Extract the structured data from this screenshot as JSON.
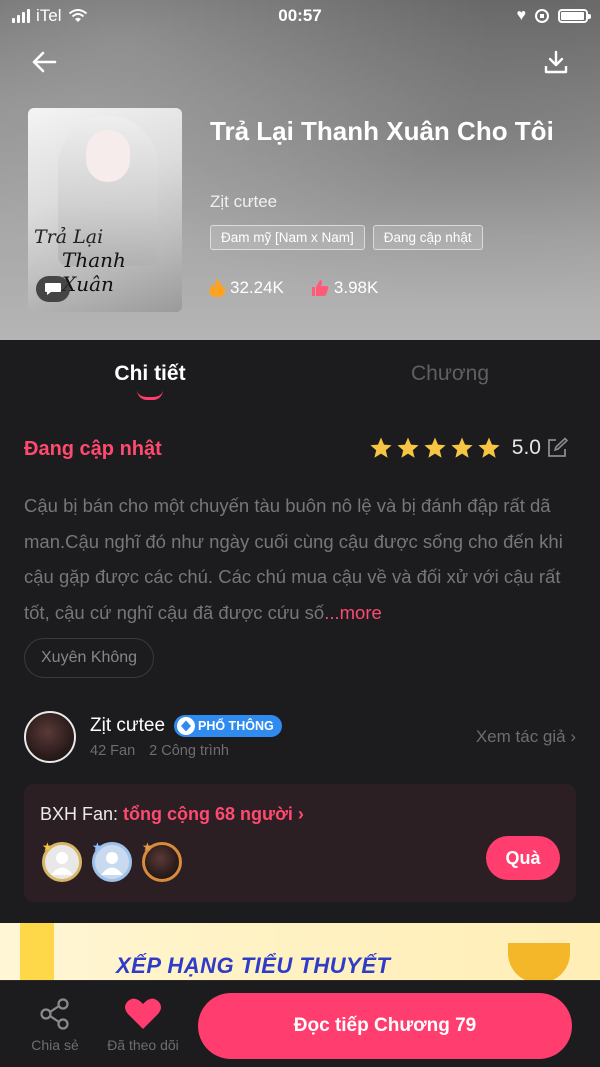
{
  "status_bar": {
    "carrier": "iTel",
    "time": "00:57",
    "battery_level": 0.95
  },
  "header": {
    "back_icon": "arrow-left-icon",
    "download_icon": "download-icon"
  },
  "book": {
    "cover_title_line1": "Trả Lại",
    "cover_title_line2": "Thanh Xuân",
    "title": "Trả Lại Thanh Xuân Cho Tôi",
    "author": "Zịt cưtee",
    "tags": [
      "Đam mỹ [Nam x Nam]",
      "Đang cập nhật"
    ],
    "views": "32.24K",
    "likes": "3.98K"
  },
  "tabs": [
    {
      "label": "Chi tiết",
      "active": true
    },
    {
      "label": "Chương",
      "active": false
    }
  ],
  "detail": {
    "status": "Đang cập nhật",
    "stars": 5,
    "rating": "5.0",
    "description": "Cậu bị bán cho một chuyến tàu buôn nô lệ và bị đánh đập rất dã man.Cậu nghĩ đó như ngày cuối cùng cậu được sống cho đến khi cậu gặp được các chú. Các chú mua cậu về và đối xử với cậu rất tốt, cậu cứ nghĩ cậu đã được cứu số",
    "more": "...more",
    "genre": "Xuyên Không"
  },
  "author_card": {
    "name": "Zịt cưtee",
    "badge": "PHỔ THÔNG",
    "fans": "42 Fan",
    "works": "2 Công trình",
    "view_label": "Xem tác giả ›"
  },
  "fan_box": {
    "label": "BXH Fan:",
    "total": "tổng cộng 68 người ›",
    "gift_button": "Quà"
  },
  "banner": {
    "text": "XẾP HẠNG TIỂU THUYẾT"
  },
  "bottom_bar": {
    "share_label": "Chia sẻ",
    "follow_label": "Đã theo dõi",
    "read_label": "Đọc tiếp Chương 79"
  },
  "colors": {
    "accent": "#ff3d6e",
    "background": "#1c1c1e",
    "badge": "#2f8bf0",
    "star": "#f6c542"
  }
}
